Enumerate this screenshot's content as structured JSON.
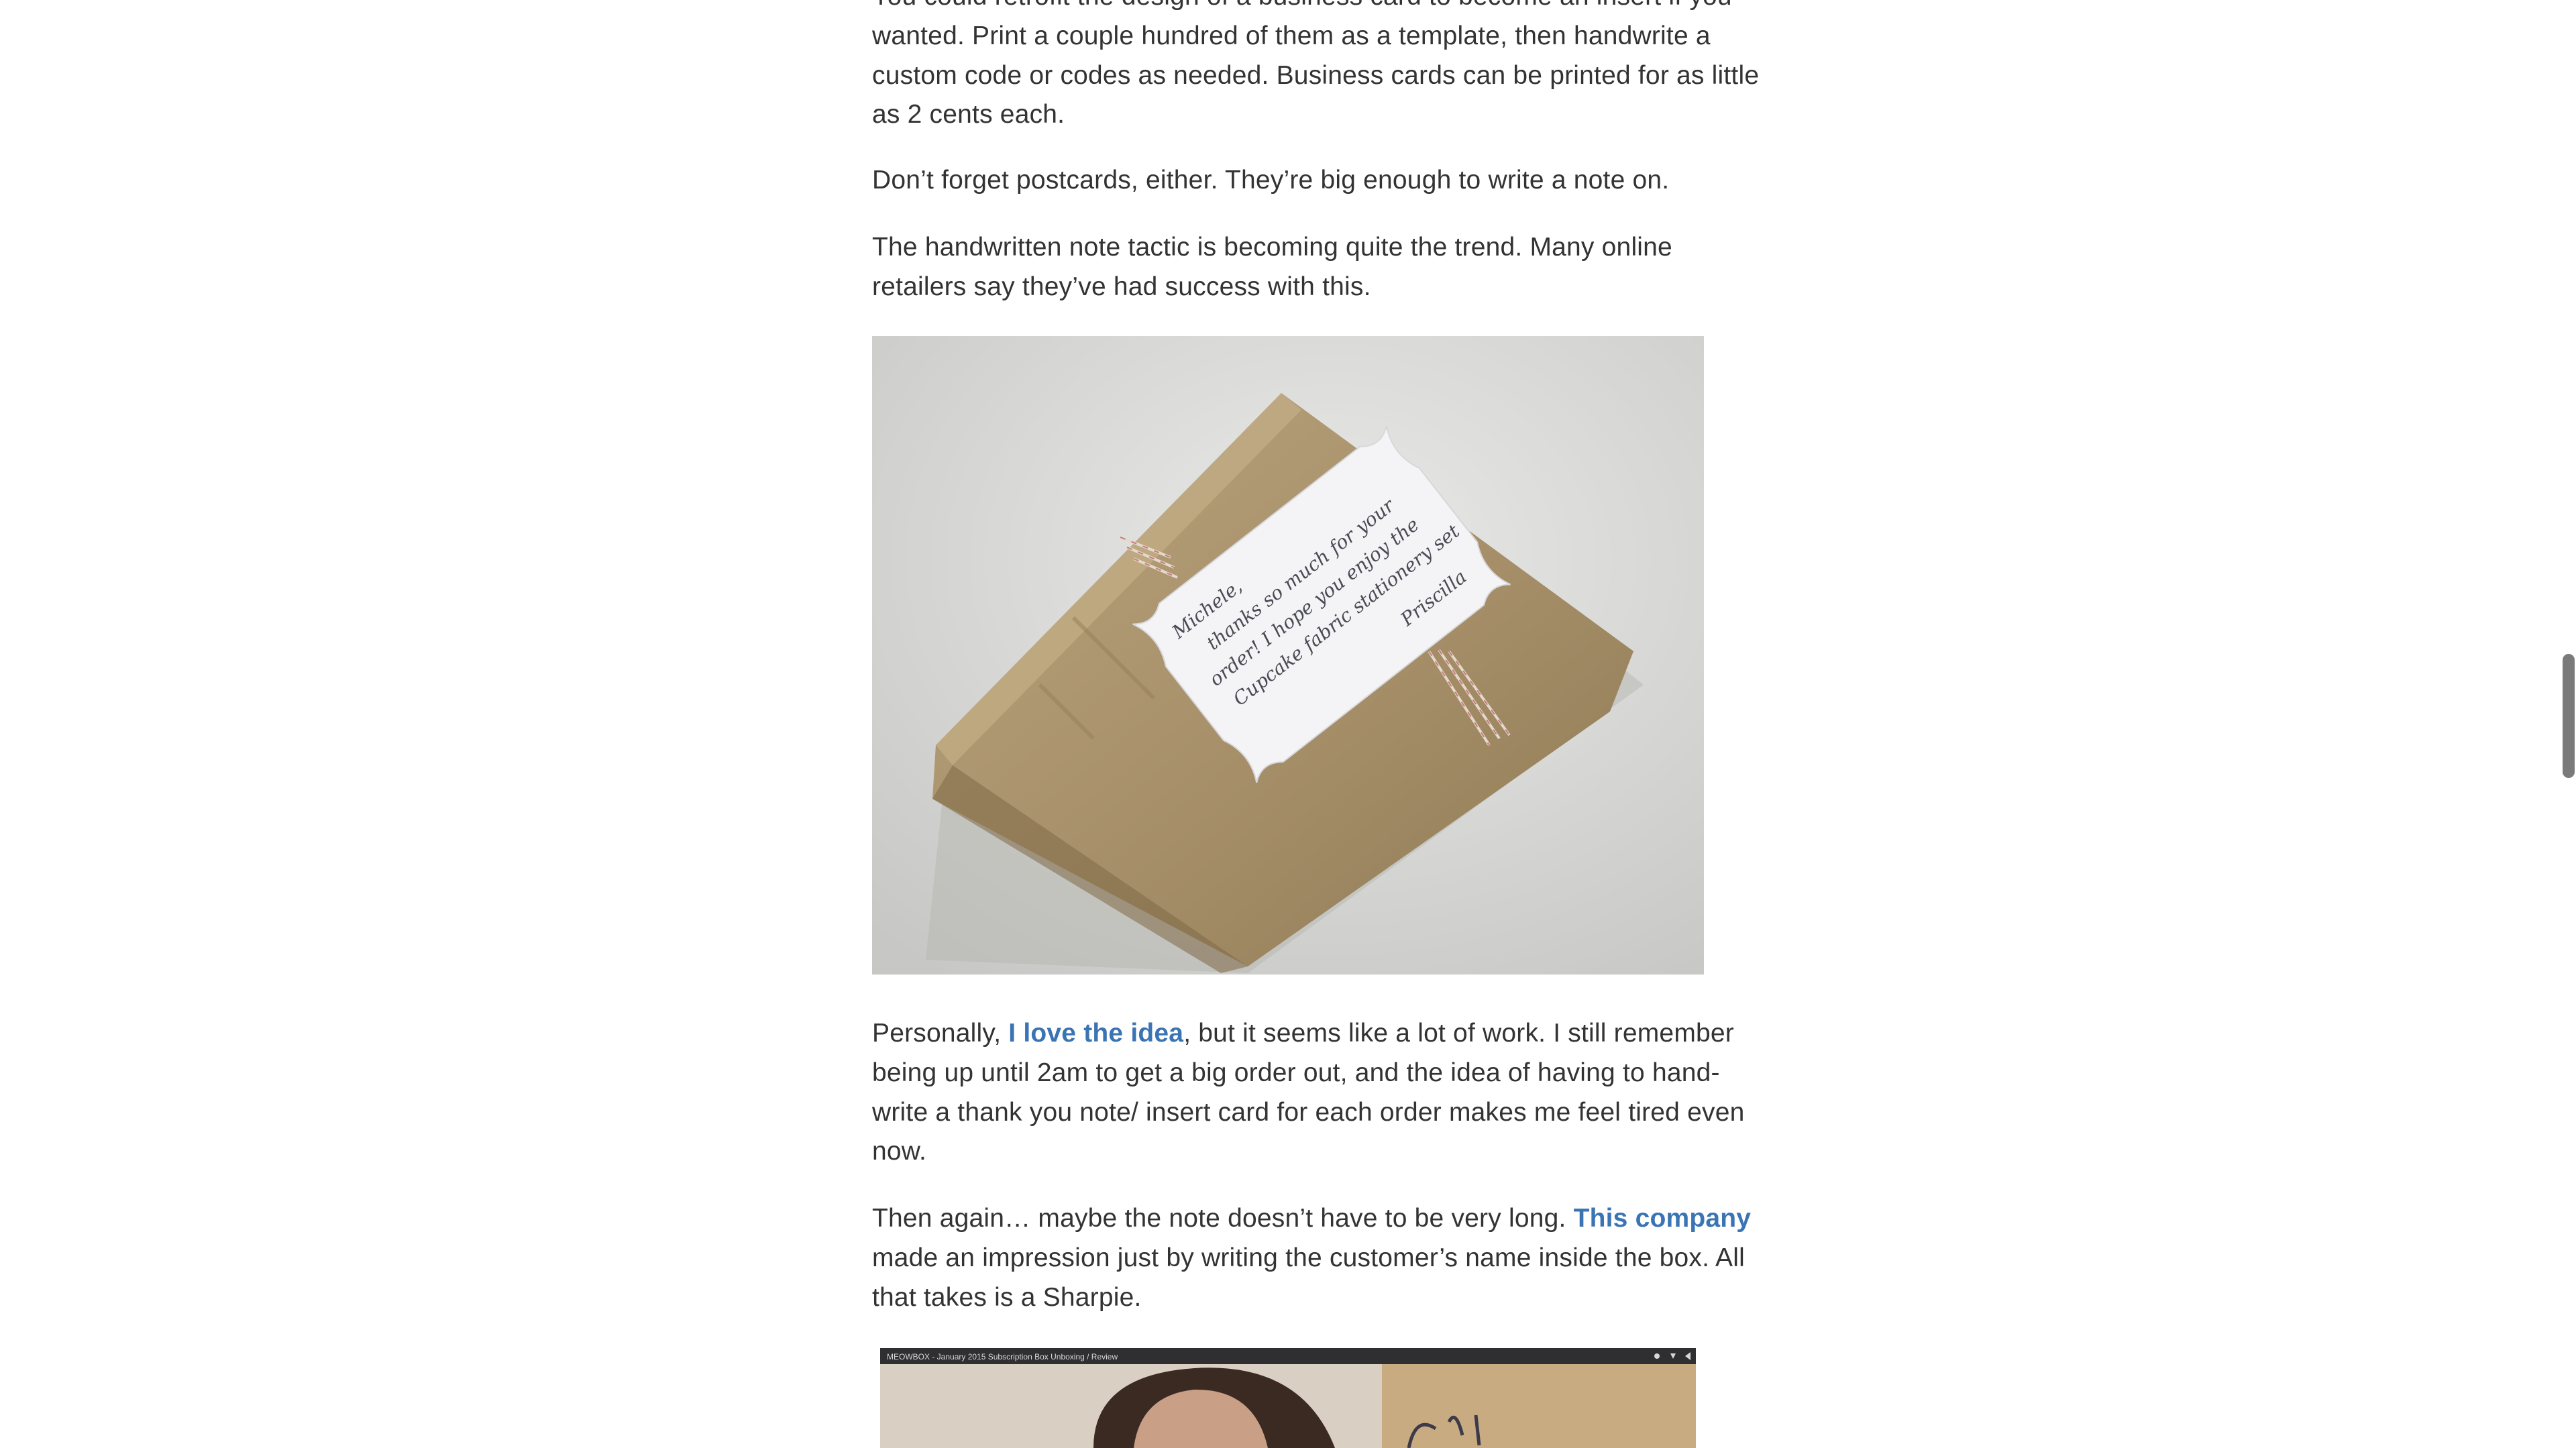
{
  "article": {
    "p1": {
      "lines": [
        "You could retrofit the design of a business card to become an insert if you",
        "wanted. Print a couple hundred of them as a template, then handwrite a",
        "custom code or codes as needed. Business cards can be printed for as little",
        "as 2 cents each."
      ]
    },
    "p2": {
      "text": "Don’t forget postcards, either. They’re big enough to write a note on."
    },
    "p3": {
      "lines": [
        "The handwritten note tactic is becoming quite the trend. Many online",
        "retailers say they’ve had success with this."
      ]
    },
    "image1": {
      "card_text": [
        "Michele,",
        "thanks so much for your",
        "order! I hope you enjoy the",
        "Cupcake fabric stationery set",
        "Priscilla"
      ]
    },
    "p4": {
      "pre": "Personally, ",
      "link": "I love the idea",
      "line1_post": ", but it seems like a lot of work. I still remember",
      "lines": [
        "being up until 2am to get a big order out, and the idea of having to hand-",
        "write a thank you note/ insert card for each order makes me feel tired even",
        "now."
      ]
    },
    "p5": {
      "pre": "Then again… maybe the note doesn’t have to be very long. ",
      "link": "This company",
      "lines": [
        "made an impression just by writing the customer’s name inside the box. All",
        "that takes is a Sharpie."
      ]
    },
    "video": {
      "title": "MEOWBOX - January 2015 Subscription Box Unboxing / Review"
    }
  },
  "colors": {
    "text": "#333333",
    "link": "#3b74b4",
    "background": "#ffffff",
    "scrollbar": "#7a7a7a"
  }
}
